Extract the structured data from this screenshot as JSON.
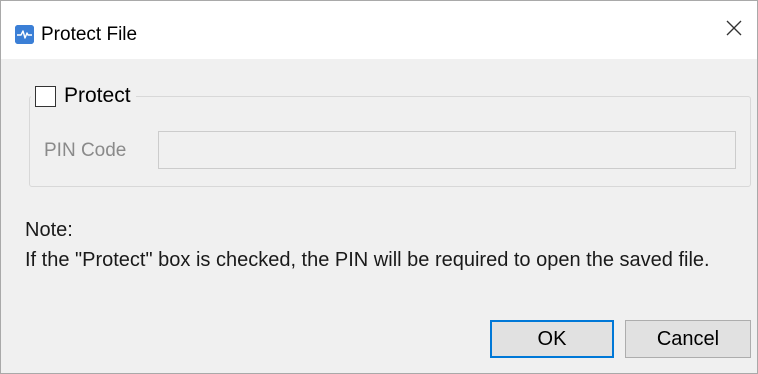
{
  "window": {
    "title": "Protect File",
    "icon": "app-logo-icon",
    "close_icon": "close-icon"
  },
  "protect": {
    "label": "Protect",
    "checked": false
  },
  "pin": {
    "label": "PIN Code",
    "value": "",
    "placeholder": ""
  },
  "note": {
    "heading": "Note:",
    "body": "If the \"Protect\" box is checked, the PIN will be required to open the saved file."
  },
  "buttons": {
    "ok": "OK",
    "cancel": "Cancel"
  },
  "colors": {
    "accent": "#0078d7",
    "icon_bg": "#3b7fd6",
    "dialog_bg": "#f0f0f0",
    "disabled_text": "#8a8a8a"
  }
}
